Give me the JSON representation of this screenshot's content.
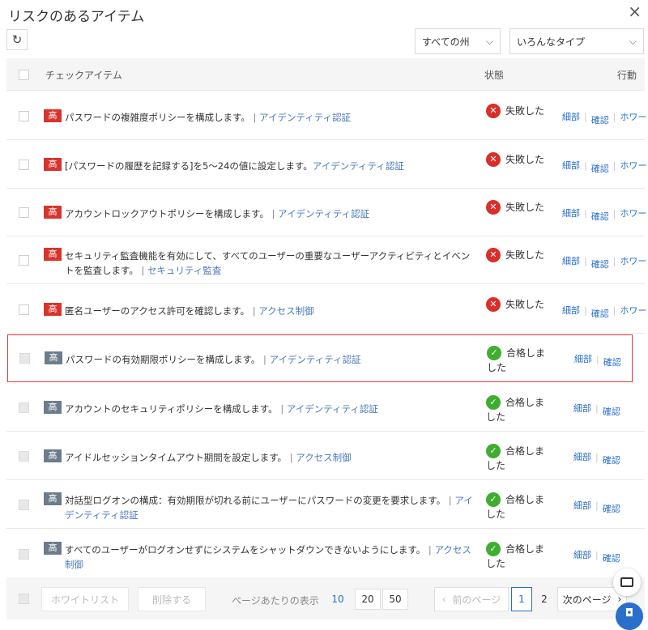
{
  "title": "リスクのあるアイテム",
  "close_icon": "×",
  "refresh_icon": "↻",
  "filters": {
    "state": "すべての州",
    "type": "いろんなタイプ"
  },
  "header": {
    "check": "チェックアイテム",
    "status": "状態",
    "action": "行動"
  },
  "actions": {
    "detail": "細部",
    "confirm": "確認",
    "whitelist": "ホワー"
  },
  "rows": [
    {
      "severity": "高",
      "text": "パスワードの複雑度ポリシーを構成します。",
      "sep": " | ",
      "category": "アイデンティティ認証",
      "status": "失敗した",
      "result": "fail"
    },
    {
      "severity": "高",
      "text": "[パスワードの履歴を記録する]を5〜24の値に設定します。",
      "sep": "",
      "category": "アイデンティティ認証",
      "status": "失敗した",
      "result": "fail"
    },
    {
      "severity": "高",
      "text": "アカウントロックアウトポリシーを構成します。",
      "sep": " | ",
      "category": "アイデンティティ認証",
      "status": "失敗した",
      "result": "fail"
    },
    {
      "severity": "高",
      "text": "セキュリティ監査機能を有効にして、すべてのユーザーの重要なユーザーアクティビティとイベントを監査します。",
      "sep": " | ",
      "category": "セキュリティ監査",
      "status": "失敗した",
      "result": "fail"
    },
    {
      "severity": "高",
      "text": "匿名ユーザーのアクセス許可を確認します。",
      "sep": " | ",
      "category": "アクセス制御",
      "status": "失敗した",
      "result": "fail"
    },
    {
      "severity": "高",
      "text": "パスワードの有効期限ポリシーを構成します。",
      "sep": " | ",
      "category": "アイデンティティ認証",
      "status": "合格しました",
      "result": "pass"
    },
    {
      "severity": "高",
      "text": "アカウントのセキュリティポリシーを構成します。",
      "sep": " | ",
      "category": "アイデンティティ認証",
      "status": "合格しました",
      "result": "pass"
    },
    {
      "severity": "高",
      "text": "アイドルセッションタイムアウト期間を設定します。",
      "sep": " | ",
      "category": "アクセス制御",
      "status": "合格しました",
      "result": "pass"
    },
    {
      "severity": "高",
      "text": "対話型ログオンの構成：有効期限が切れる前にユーザーにパスワードの変更を要求します。",
      "sep": " | ",
      "category": "アイデンティティ認証",
      "status": "合格しました",
      "result": "pass"
    },
    {
      "severity": "高",
      "text": "すべてのユーザーがログオンせずにシステムをシャットダウンできないようにします。",
      "sep": " | ",
      "category": "アクセス制御",
      "status": "合格しました",
      "result": "pass"
    }
  ],
  "footer": {
    "whitelist": "ホワイトリスト",
    "delete": "削除する",
    "per_page_label": "ページあたりの表示",
    "per_page_options": [
      "10",
      "20",
      "50"
    ],
    "prev": "前のページ",
    "pages": [
      "1",
      "2"
    ],
    "next": "次のページ"
  },
  "colors": {
    "fail": "#d92f2a",
    "pass": "#3fad2f",
    "high_badge_fail": "#d9342b",
    "high_badge_pass": "#6d7c8c",
    "link": "#2a6fc9",
    "highlight": "#e03a3a"
  }
}
